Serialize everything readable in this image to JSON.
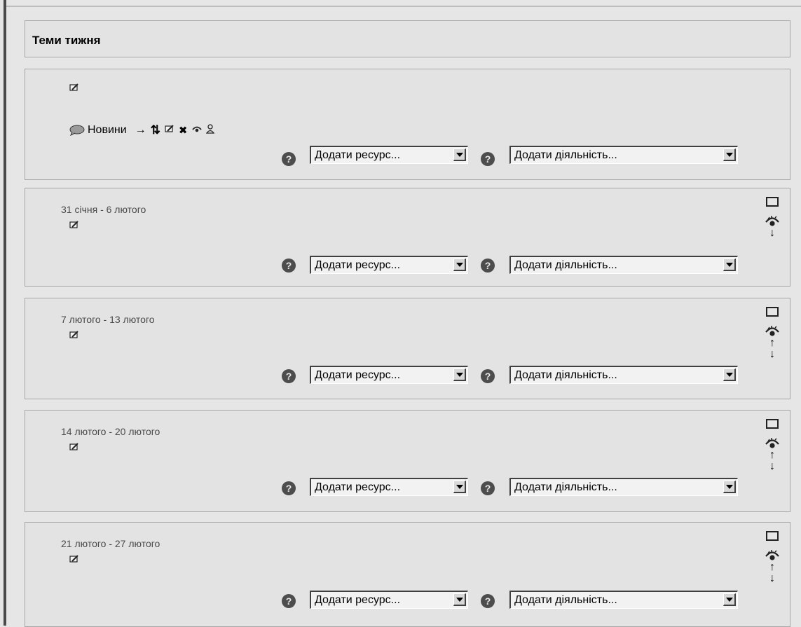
{
  "section_header": {
    "title": "Теми тижня"
  },
  "section0": {
    "news_label": "Новини",
    "add_resource": "Додати ресурс...",
    "add_activity": "Додати діяльність..."
  },
  "weeks": [
    {
      "title": "31 січня - 6 лютого",
      "add_resource": "Додати ресурс...",
      "add_activity": "Додати діяльність..."
    },
    {
      "title": "7 лютого - 13 лютого",
      "add_resource": "Додати ресурс...",
      "add_activity": "Додати діяльність..."
    },
    {
      "title": "14 лютого - 20 лютого",
      "add_resource": "Додати ресурс...",
      "add_activity": "Додати діяльність..."
    },
    {
      "title": "21 лютого - 27 лютого",
      "add_resource": "Додати ресурс...",
      "add_activity": "Додати діяльність..."
    }
  ],
  "icons": {
    "help": "?",
    "arrow_up": "↑",
    "arrow_down": "↓",
    "arrow_right": "→",
    "move_updown": "⇅",
    "delete": "✖"
  }
}
